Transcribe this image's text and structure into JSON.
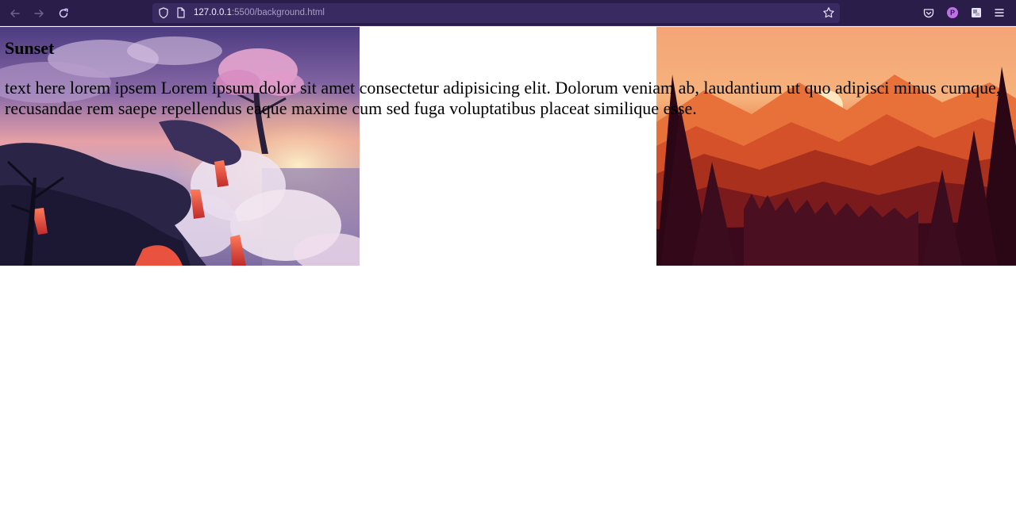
{
  "browser": {
    "url_host": "127.0.0.1",
    "url_path": ":5500/background.html",
    "profile_initial": "P",
    "theme_color": "#2b1d4a",
    "icons": [
      "back-icon",
      "forward-icon",
      "reload-icon",
      "shield-icon",
      "page-icon",
      "star-icon",
      "pocket-icon",
      "avatar",
      "extension-icon",
      "menu-icon"
    ]
  },
  "page": {
    "heading": "Sunset",
    "paragraph": "text here lorem ipsem Lorem ipsum dolor sit amet consectetur adipisicing elit. Dolorum veniam ab, laudantium ut quo adipisci minus cumque, recusandae rem saepe repellendus eaque maxime cum sed fuga voluptatibus placeat similique esse."
  }
}
